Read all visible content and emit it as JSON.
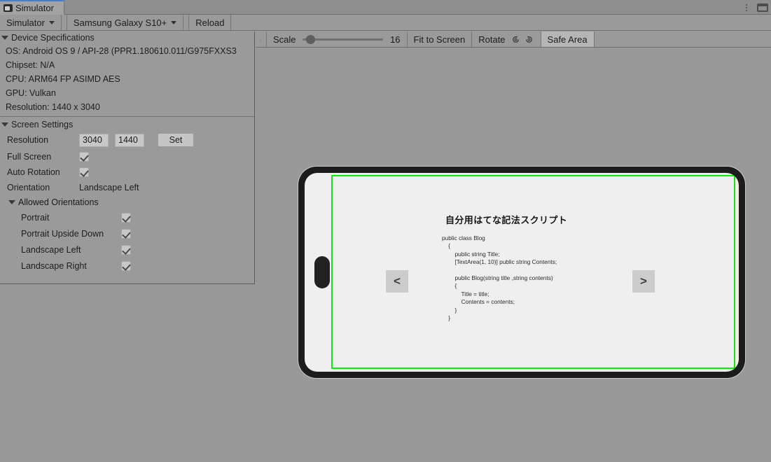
{
  "window": {
    "tab_label": "Simulator",
    "tab_icon": "device-icon",
    "kebab_icon": "kebab-menu-icon",
    "window_icon": "window-layout-icon"
  },
  "toolbar": {
    "mode_label": "Simulator",
    "device_label": "Samsung Galaxy S10+",
    "reload_label": "Reload"
  },
  "view_toolbar": {
    "back_chevron": "chevron-left-icon",
    "scale_label": "Scale",
    "scale_value": "16",
    "fit_to_screen_label": "Fit to Screen",
    "rotate_label": "Rotate",
    "rotate_ccw_icon": "rotate-counterclockwise-icon",
    "rotate_cw_icon": "rotate-clockwise-icon",
    "safe_area_label": "Safe Area"
  },
  "inspector": {
    "device_specs": {
      "title": "Device Specifications",
      "lines": [
        "OS: Android OS 9 / API-28 (PPR1.180610.011/G975FXXS3",
        "Chipset: N/A",
        "CPU: ARM64 FP ASIMD AES",
        "GPU: Vulkan",
        "Resolution: 1440 x 3040"
      ]
    },
    "screen_settings": {
      "title": "Screen Settings",
      "resolution_label": "Resolution",
      "resolution_width": "3040",
      "resolution_height": "1440",
      "set_label": "Set",
      "full_screen_label": "Full Screen",
      "full_screen_checked": true,
      "auto_rotation_label": "Auto Rotation",
      "auto_rotation_checked": true,
      "orientation_label": "Orientation",
      "orientation_value": "Landscape Left",
      "allowed_orientations_title": "Allowed Orientations",
      "allowed_orientations": [
        {
          "label": "Portrait",
          "checked": true
        },
        {
          "label": "Portrait Upside Down",
          "checked": true
        },
        {
          "label": "Landscape Left",
          "checked": true
        },
        {
          "label": "Landscape Right",
          "checked": true
        }
      ]
    }
  },
  "device_screen": {
    "blog_title": "自分用はてな記法スクリプト",
    "code": "public class Blog\n    {\n        public string Title;\n        [TextArea(1, 10)] public string Contents;\n\n        public Blog(string title ,string contents)\n        {\n            Title = title;\n            Contents = contents;\n        }\n    }",
    "prev_button": "<",
    "next_button": ">",
    "safe_area_color": "#12e512"
  }
}
